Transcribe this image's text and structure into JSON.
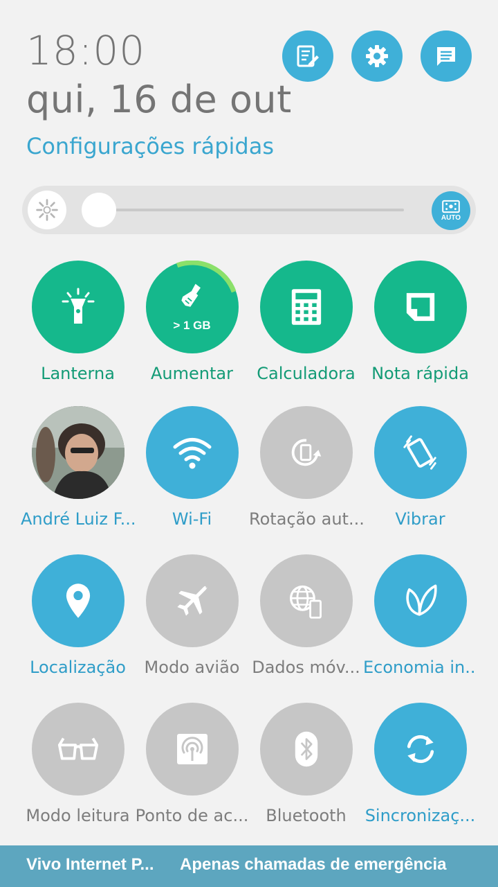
{
  "header": {
    "time": "18:00",
    "date": "qui, 16 de out",
    "quick_settings_title": "Configurações rápidas"
  },
  "top_buttons": [
    {
      "icon": "edit-list-icon"
    },
    {
      "icon": "gear-icon"
    },
    {
      "icon": "notifications-list-icon"
    }
  ],
  "brightness": {
    "level": 0.03,
    "auto_label": "AUTO"
  },
  "tiles": [
    {
      "label": "Lanterna",
      "icon": "flashlight-icon",
      "state": "green"
    },
    {
      "label": "Aumentar",
      "icon": "boost-broom-icon",
      "state": "green",
      "badge": "> 1 GB"
    },
    {
      "label": "Calculadora",
      "icon": "calculator-icon",
      "state": "green"
    },
    {
      "label": "Nota rápida",
      "icon": "quick-note-icon",
      "state": "green"
    },
    {
      "label": "André Luiz F...",
      "icon": "avatar",
      "state": "avatar"
    },
    {
      "label": "Wi-Fi",
      "icon": "wifi-icon",
      "state": "on"
    },
    {
      "label": "Rotação aut...",
      "icon": "auto-rotate-icon",
      "state": "off"
    },
    {
      "label": "Vibrar",
      "icon": "vibrate-icon",
      "state": "on"
    },
    {
      "label": "Localização",
      "icon": "location-pin-icon",
      "state": "on"
    },
    {
      "label": "Modo avião",
      "icon": "airplane-icon",
      "state": "off"
    },
    {
      "label": "Dados móv...",
      "icon": "mobile-data-icon",
      "state": "off"
    },
    {
      "label": "Economia in...",
      "icon": "leaf-icon",
      "state": "on"
    },
    {
      "label": "Modo leitura",
      "icon": "glasses-icon",
      "state": "off"
    },
    {
      "label": "Ponto de ac...",
      "icon": "hotspot-icon",
      "state": "off"
    },
    {
      "label": "Bluetooth",
      "icon": "bluetooth-icon",
      "state": "off"
    },
    {
      "label": "Sincronizaç...",
      "icon": "sync-icon",
      "state": "on"
    }
  ],
  "status_bar": {
    "carrier": "Vivo Internet P...",
    "message": "Apenas chamadas de emergência"
  },
  "colors": {
    "accent_blue": "#3fb0d8",
    "accent_green": "#15b88c",
    "off_gray": "#c6c6c6",
    "status_bar": "#5da6bf"
  }
}
